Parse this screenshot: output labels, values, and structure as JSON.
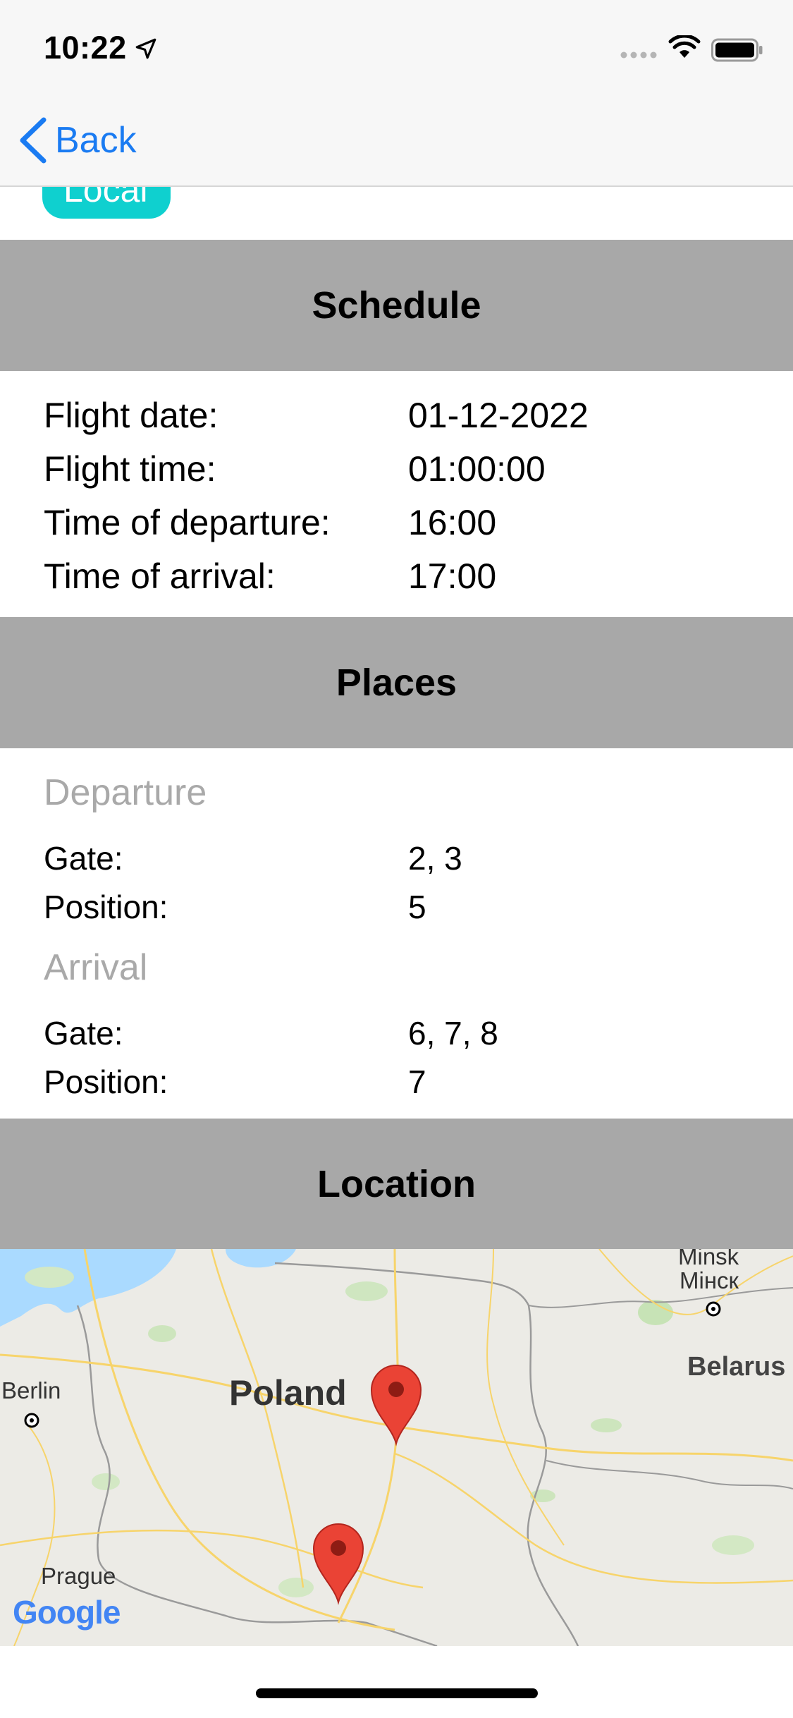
{
  "status_bar": {
    "time": "10:22"
  },
  "nav": {
    "back_label": "Back"
  },
  "badge": {
    "label": "Local"
  },
  "schedule": {
    "header": "Schedule",
    "rows": [
      {
        "label": "Flight date:",
        "value": "01-12-2022"
      },
      {
        "label": "Flight time:",
        "value": "01:00:00"
      },
      {
        "label": "Time of departure:",
        "value": "16:00"
      },
      {
        "label": "Time of arrival:",
        "value": "17:00"
      }
    ]
  },
  "places": {
    "header": "Places",
    "departure": {
      "title": "Departure",
      "gate_label": "Gate:",
      "gate_value": "2, 3",
      "position_label": "Position:",
      "position_value": "5"
    },
    "arrival": {
      "title": "Arrival",
      "gate_label": "Gate:",
      "gate_value": "6, 7, 8",
      "position_label": "Position:",
      "position_value": "7"
    }
  },
  "location": {
    "header": "Location",
    "map": {
      "labels": {
        "minsk_latin": "Minsk",
        "minsk_cyrillic": "Мінск",
        "belarus": "Belarus",
        "berlin": "Berlin",
        "poland": "Poland",
        "prague": "Prague",
        "google": "Google"
      },
      "markers": 2
    }
  },
  "colors": {
    "accent": "#1a7bf2",
    "header_bg": "#a8a8a8",
    "badge_bg": "#0fd0cf",
    "subtitle": "#a9a9a9",
    "marker": "#ea4335"
  }
}
